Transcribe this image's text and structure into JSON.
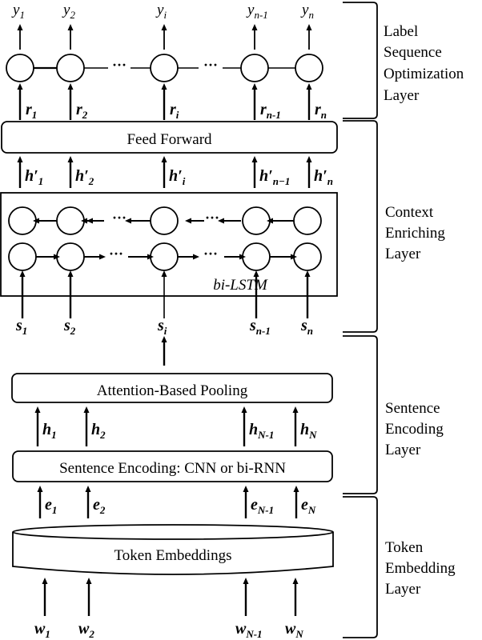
{
  "outputs": [
    {
      "base": "y",
      "sub": "1"
    },
    {
      "base": "y",
      "sub": "2"
    },
    {
      "base": "y",
      "sub": "i"
    },
    {
      "base": "y",
      "sub": "n-1"
    },
    {
      "base": "y",
      "sub": "n"
    }
  ],
  "r_labels": [
    {
      "base": "r",
      "sub": "1"
    },
    {
      "base": "r",
      "sub": "2"
    },
    {
      "base": "r",
      "sub": "i"
    },
    {
      "base": "r",
      "sub": "n-1"
    },
    {
      "base": "r",
      "sub": "n"
    }
  ],
  "h_prime_labels": [
    {
      "base": "h′",
      "sub": "1"
    },
    {
      "base": "h′",
      "sub": "2"
    },
    {
      "base": "h′",
      "sub": "i"
    },
    {
      "base": "h′",
      "sub": "n−1"
    },
    {
      "base": "h′",
      "sub": "n"
    }
  ],
  "s_labels": [
    {
      "base": "s",
      "sub": "1"
    },
    {
      "base": "s",
      "sub": "2"
    },
    {
      "base": "s",
      "sub": "i"
    },
    {
      "base": "s",
      "sub": "n-1"
    },
    {
      "base": "s",
      "sub": "n"
    }
  ],
  "h_labels": [
    {
      "base": "h",
      "sub": "1"
    },
    {
      "base": "h",
      "sub": "2"
    },
    {
      "base": "h",
      "sub": "N-1"
    },
    {
      "base": "h",
      "sub": "N"
    }
  ],
  "e_labels": [
    {
      "base": "e",
      "sub": "1"
    },
    {
      "base": "e",
      "sub": "2"
    },
    {
      "base": "e",
      "sub": "N-1"
    },
    {
      "base": "e",
      "sub": "N"
    }
  ],
  "w_labels": [
    {
      "base": "w",
      "sub": "1"
    },
    {
      "base": "w",
      "sub": "2"
    },
    {
      "base": "w",
      "sub": "N-1"
    },
    {
      "base": "w",
      "sub": "N"
    }
  ],
  "ellipsis": "···",
  "boxes": {
    "feed_forward": "Feed Forward",
    "bilstm": "bi-LSTM",
    "attention_pooling": "Attention-Based Pooling",
    "sentence_encoding": "Sentence Encoding: CNN or bi-RNN",
    "token_embeddings": "Token Embeddings"
  },
  "layers": [
    {
      "lines": [
        "Label",
        "Sequence",
        "Optimization",
        "Layer"
      ]
    },
    {
      "lines": [
        "Context",
        "Enriching",
        "Layer"
      ]
    },
    {
      "lines": [
        "Sentence",
        "Encoding",
        "Layer"
      ]
    },
    {
      "lines": [
        "Token",
        "Embedding",
        "Layer"
      ]
    }
  ]
}
